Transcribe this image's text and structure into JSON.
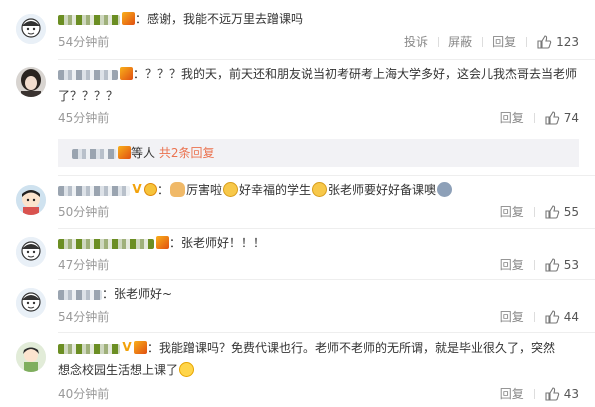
{
  "comments": [
    {
      "text": "：感谢，我能不远万里去蹭课吗",
      "time": "54分钟前",
      "actions": [
        "投诉",
        "屏蔽",
        "回复"
      ],
      "likes": "123"
    },
    {
      "text_line1": "：？？？我的天，前天还和朋友说当初考研考上海大学多好，这会儿我杰哥去当老师",
      "text_line2": "了？？？？",
      "time": "45分钟前",
      "reply_label": "回复",
      "likes": "74",
      "subreplies": {
        "suffix": "等人",
        "more": "共2条回复"
      }
    },
    {
      "text_a": "：",
      "text_b": "厉害啦",
      "text_c": "好幸福的学生",
      "text_d": "张老师要好好备课噢",
      "time": "50分钟前",
      "reply_label": "回复",
      "likes": "55",
      "emoji": [
        "hands-emoji",
        "doge-emoji",
        "doge-emoji",
        "face-emoji"
      ]
    },
    {
      "text": "：张老师好！！！",
      "time": "47分钟前",
      "reply_label": "回复",
      "likes": "53"
    },
    {
      "text": "：张老师好~",
      "time": "54分钟前",
      "reply_label": "回复",
      "likes": "44"
    },
    {
      "text_line1": "：我能蹭课吗？免费代课也行。老师不老师的无所谓，就是毕业很久了，突然",
      "text_line2": "想念校园生活想上课了",
      "time": "40分钟前",
      "reply_label": "回复",
      "likes": "43",
      "emoji": [
        "laugh-cry-emoji"
      ]
    }
  ],
  "icons": {
    "like": "thumbs-up-icon",
    "avatar": "avatar-image"
  },
  "colors": {
    "link_orange": "#eb7350",
    "meta_gray": "#999999",
    "sub_bg": "#f2f2f5"
  }
}
